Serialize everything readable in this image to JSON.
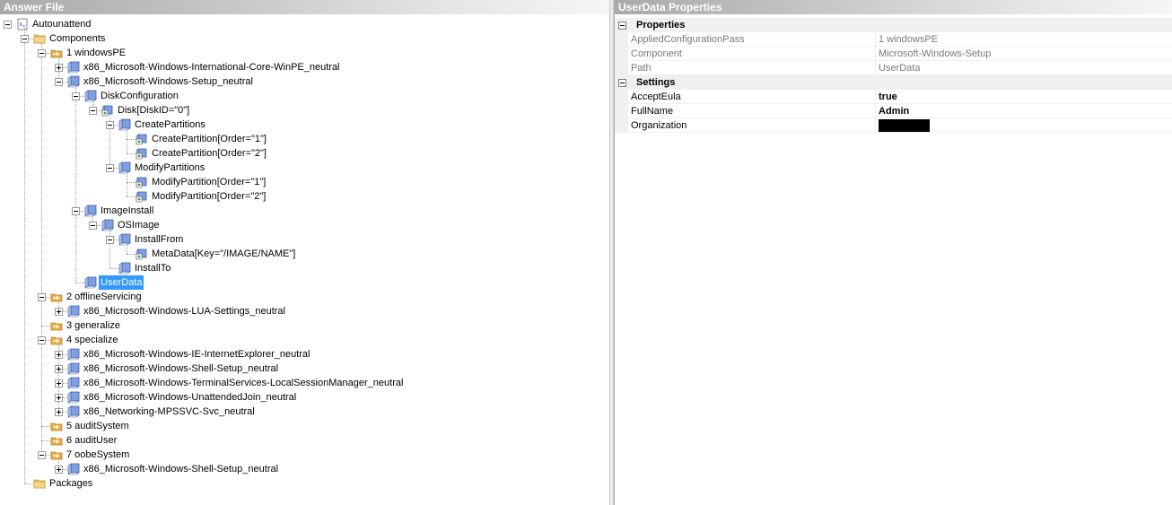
{
  "left_pane": {
    "title": "Answer File",
    "tree": [
      {
        "label": "Autounattend",
        "depth": 0,
        "toggle": "minus",
        "icon": "answer-file-icon"
      },
      {
        "label": "Components",
        "depth": 1,
        "toggle": "minus",
        "icon": "folder-icon"
      },
      {
        "label": "1 windowsPE",
        "depth": 2,
        "toggle": "minus",
        "icon": "config-pass-icon"
      },
      {
        "label": "x86_Microsoft-Windows-International-Core-WinPE_neutral",
        "depth": 3,
        "toggle": "plus",
        "icon": "component-icon"
      },
      {
        "label": "x86_Microsoft-Windows-Setup_neutral",
        "depth": 3,
        "toggle": "minus",
        "icon": "component-icon"
      },
      {
        "label": "DiskConfiguration",
        "depth": 4,
        "toggle": "minus",
        "icon": "setting-icon"
      },
      {
        "label": "Disk[DiskID=\"0\"]",
        "depth": 5,
        "toggle": "minus",
        "icon": "list-item-icon"
      },
      {
        "label": "CreatePartitions",
        "depth": 6,
        "toggle": "minus",
        "icon": "setting-icon"
      },
      {
        "label": "CreatePartition[Order=\"1\"]",
        "depth": 7,
        "toggle": "none",
        "icon": "list-item-icon"
      },
      {
        "label": "CreatePartition[Order=\"2\"]",
        "depth": 7,
        "toggle": "none",
        "icon": "list-item-icon"
      },
      {
        "label": "ModifyPartitions",
        "depth": 6,
        "toggle": "minus",
        "icon": "setting-icon"
      },
      {
        "label": "ModifyPartition[Order=\"1\"]",
        "depth": 7,
        "toggle": "none",
        "icon": "list-item-icon"
      },
      {
        "label": "ModifyPartition[Order=\"2\"]",
        "depth": 7,
        "toggle": "none",
        "icon": "list-item-icon"
      },
      {
        "label": "ImageInstall",
        "depth": 4,
        "toggle": "minus",
        "icon": "setting-icon"
      },
      {
        "label": "OSImage",
        "depth": 5,
        "toggle": "minus",
        "icon": "setting-icon"
      },
      {
        "label": "InstallFrom",
        "depth": 6,
        "toggle": "minus",
        "icon": "setting-icon"
      },
      {
        "label": "MetaData[Key=\"/IMAGE/NAME\"]",
        "depth": 7,
        "toggle": "none",
        "icon": "list-item-icon"
      },
      {
        "label": "InstallTo",
        "depth": 6,
        "toggle": "none",
        "icon": "setting-icon"
      },
      {
        "label": "UserData",
        "depth": 4,
        "toggle": "none",
        "icon": "setting-icon",
        "selected": true
      },
      {
        "label": "2 offlineServicing",
        "depth": 2,
        "toggle": "minus",
        "icon": "config-pass-icon"
      },
      {
        "label": "x86_Microsoft-Windows-LUA-Settings_neutral",
        "depth": 3,
        "toggle": "plus",
        "icon": "component-icon"
      },
      {
        "label": "3 generalize",
        "depth": 2,
        "toggle": "none",
        "icon": "config-pass-icon"
      },
      {
        "label": "4 specialize",
        "depth": 2,
        "toggle": "minus",
        "icon": "config-pass-icon"
      },
      {
        "label": "x86_Microsoft-Windows-IE-InternetExplorer_neutral",
        "depth": 3,
        "toggle": "plus",
        "icon": "component-icon"
      },
      {
        "label": "x86_Microsoft-Windows-Shell-Setup_neutral",
        "depth": 3,
        "toggle": "plus",
        "icon": "component-icon"
      },
      {
        "label": "x86_Microsoft-Windows-TerminalServices-LocalSessionManager_neutral",
        "depth": 3,
        "toggle": "plus",
        "icon": "component-icon"
      },
      {
        "label": "x86_Microsoft-Windows-UnattendedJoin_neutral",
        "depth": 3,
        "toggle": "plus",
        "icon": "component-icon"
      },
      {
        "label": "x86_Networking-MPSSVC-Svc_neutral",
        "depth": 3,
        "toggle": "plus",
        "icon": "component-icon"
      },
      {
        "label": "5 auditSystem",
        "depth": 2,
        "toggle": "none",
        "icon": "config-pass-icon"
      },
      {
        "label": "6 auditUser",
        "depth": 2,
        "toggle": "none",
        "icon": "config-pass-icon"
      },
      {
        "label": "7 oobeSystem",
        "depth": 2,
        "toggle": "minus",
        "icon": "config-pass-icon"
      },
      {
        "label": "x86_Microsoft-Windows-Shell-Setup_neutral",
        "depth": 3,
        "toggle": "plus",
        "icon": "component-icon"
      },
      {
        "label": "Packages",
        "depth": 1,
        "toggle": "none",
        "icon": "folder-icon"
      }
    ]
  },
  "right_pane": {
    "title": "UserData Properties",
    "categories": [
      {
        "name": "Properties",
        "rows": [
          {
            "name": "AppliedConfigurationPass",
            "value": "1 windowsPE",
            "readonly": true
          },
          {
            "name": "Component",
            "value": "Microsoft-Windows-Setup",
            "readonly": true
          },
          {
            "name": "Path",
            "value": "UserData",
            "readonly": true
          }
        ]
      },
      {
        "name": "Settings",
        "rows": [
          {
            "name": "AcceptEula",
            "value": "true",
            "readonly": false,
            "bold": true
          },
          {
            "name": "FullName",
            "value": "Admin",
            "readonly": false,
            "bold": true
          },
          {
            "name": "Organization",
            "value": "",
            "readonly": false,
            "redacted": true
          }
        ]
      }
    ]
  },
  "colors": {
    "selection": "#3399ff",
    "folder": "#f2c46d",
    "component": "#7f9fe0",
    "config_pass": "#e8b04a",
    "readonly_text": "#7a7a7a"
  }
}
